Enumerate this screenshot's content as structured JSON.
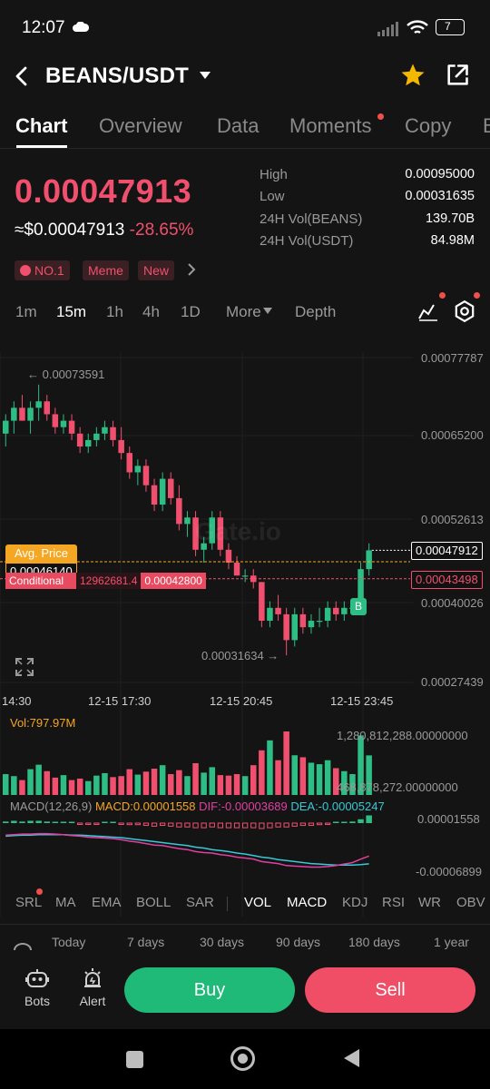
{
  "status_bar": {
    "time": "12:07",
    "battery": "7"
  },
  "header": {
    "pair": "BEANS/USDT"
  },
  "tabs": [
    {
      "label": "Chart",
      "active": true
    },
    {
      "label": "Overview"
    },
    {
      "label": "Data"
    },
    {
      "label": "Moments",
      "dot": true
    },
    {
      "label": "Copy"
    },
    {
      "label": "B"
    }
  ],
  "price": {
    "last": "0.00047913",
    "usd": "≈$0.00047913",
    "change": "-28.65%"
  },
  "tags": [
    "NO.1",
    "Meme",
    "New"
  ],
  "stats": [
    {
      "label": "High",
      "value": "0.00095000"
    },
    {
      "label": "Low",
      "value": "0.00031635"
    },
    {
      "label": "24H Vol(BEANS)",
      "value": "139.70B"
    },
    {
      "label": "24H Vol(USDT)",
      "value": "84.98M"
    }
  ],
  "timeframes": [
    "1m",
    "15m",
    "1h",
    "4h",
    "1D",
    "More",
    "Depth"
  ],
  "active_timeframe": "15m",
  "chart": {
    "y_ticks": [
      "0.00077787",
      "0.00065200",
      "0.00052613",
      "0.00040026",
      "0.00027439"
    ],
    "x_ticks": [
      "14:30",
      "12-15 17:30",
      "12-15 20:45",
      "12-15 23:45"
    ],
    "high_marker": "← 0.00073591",
    "low_marker": "0.00031634 →",
    "current_price": "0.00047912",
    "conditional_price": "0.00043498",
    "avg_price_label": "Avg. Price",
    "avg_price_value": "0.00046140",
    "conditional_label": "Conditional",
    "conditional_qty": "12962681.4",
    "conditional_order_price": "0.00042800",
    "buy_marker": "B",
    "watermark": "Gate.io",
    "colors": {
      "up": "#2ebd85",
      "down": "#f0506e",
      "avg": "#f5a623"
    }
  },
  "volume": {
    "label": "Vol:797.97M",
    "max_tick": "1,280,812,288.00000000",
    "mid_tick": "468,878,272.00000000"
  },
  "macd": {
    "params": "MACD(12,26,9)",
    "macd_value": "MACD:0.00001558",
    "dif_value": "DIF:-0.00003689",
    "dea_value": "DEA:-0.00005247",
    "top_tick": "0.00001558",
    "bottom_tick": "-0.00006899"
  },
  "indicators": [
    "SRL",
    "MA",
    "EMA",
    "BOLL",
    "SAR",
    "VOL",
    "MACD",
    "KDJ",
    "RSI",
    "WR",
    "OBV"
  ],
  "active_indicators": [
    "VOL",
    "MACD"
  ],
  "ranges": [
    "Today",
    "7 days",
    "30 days",
    "90 days",
    "180 days",
    "1 year"
  ],
  "bottom": {
    "bots": "Bots",
    "alert": "Alert",
    "buy": "Buy",
    "sell": "Sell"
  },
  "chart_data": {
    "type": "candlestick",
    "ylim": [
      0.00027439,
      0.00077787
    ],
    "candles": [
      [
        0.00066,
        0.00069,
        0.00064,
        0.00068
      ],
      [
        0.00068,
        0.00071,
        0.00066,
        0.0007
      ],
      [
        0.0007,
        0.00072,
        0.00068,
        0.00068
      ],
      [
        0.00068,
        0.00071,
        0.00066,
        0.0007
      ],
      [
        0.0007,
        0.00073591,
        0.00068,
        0.00071
      ],
      [
        0.00071,
        0.00072,
        0.00068,
        0.00069
      ],
      [
        0.00069,
        0.0007,
        0.00066,
        0.00067
      ],
      [
        0.00067,
        0.00069,
        0.00066,
        0.00068
      ],
      [
        0.00068,
        0.00069,
        0.00065,
        0.00066
      ],
      [
        0.00066,
        0.00067,
        0.00063,
        0.00064
      ],
      [
        0.00064,
        0.00066,
        0.00063,
        0.00065
      ],
      [
        0.00065,
        0.00067,
        0.00064,
        0.00066
      ],
      [
        0.00066,
        0.00068,
        0.00065,
        0.00067
      ],
      [
        0.00067,
        0.00068,
        0.00064,
        0.00065
      ],
      [
        0.00065,
        0.00067,
        0.00062,
        0.00063
      ],
      [
        0.00063,
        0.00064,
        0.00059,
        0.0006
      ],
      [
        0.0006,
        0.00062,
        0.00058,
        0.00061
      ],
      [
        0.00061,
        0.00062,
        0.00057,
        0.00058
      ],
      [
        0.00058,
        0.00059,
        0.00054,
        0.00055
      ],
      [
        0.00055,
        0.0006,
        0.00054,
        0.00059
      ],
      [
        0.00059,
        0.0006,
        0.00055,
        0.00056
      ],
      [
        0.00056,
        0.00058,
        0.00051,
        0.00052
      ],
      [
        0.00052,
        0.00054,
        0.0005,
        0.00053
      ],
      [
        0.00053,
        0.00054,
        0.00047,
        0.00048
      ],
      [
        0.00048,
        0.0005,
        0.00046,
        0.00049
      ],
      [
        0.00049,
        0.00054,
        0.00048,
        0.00053
      ],
      [
        0.00053,
        0.00054,
        0.00047,
        0.00048
      ],
      [
        0.00048,
        0.00049,
        0.00045,
        0.00046
      ],
      [
        0.00046,
        0.00047,
        0.00044,
        0.00044
      ],
      [
        0.00044,
        0.00045,
        0.00043,
        0.00044
      ],
      [
        0.00044,
        0.00045,
        0.00042,
        0.00043
      ],
      [
        0.00043,
        0.00043,
        0.00036,
        0.00037
      ],
      [
        0.00037,
        0.0004,
        0.00036,
        0.00039
      ],
      [
        0.00039,
        0.00041,
        0.00037,
        0.00038
      ],
      [
        0.00038,
        0.00039,
        0.00031634,
        0.00034
      ],
      [
        0.00034,
        0.00039,
        0.00033,
        0.00038
      ],
      [
        0.00038,
        0.00039,
        0.00035,
        0.00036
      ],
      [
        0.00036,
        0.00038,
        0.00035,
        0.00037
      ],
      [
        0.00037,
        0.00039,
        0.00036,
        0.00037
      ],
      [
        0.00037,
        0.0004,
        0.00036,
        0.00039
      ],
      [
        0.00039,
        0.0004,
        0.00037,
        0.00038
      ],
      [
        0.00038,
        0.0004,
        0.00037,
        0.00039
      ],
      [
        0.00039,
        0.0004,
        0.00038,
        0.00039
      ],
      [
        0.00039,
        0.00046,
        0.00038,
        0.00045
      ],
      [
        0.00045,
        0.00049,
        0.00044,
        0.00047913
      ]
    ],
    "volume": [
      420,
      380,
      300,
      520,
      610,
      480,
      350,
      400,
      300,
      330,
      280,
      390,
      440,
      360,
      380,
      520,
      410,
      470,
      530,
      600,
      420,
      500,
      380,
      640,
      450,
      560,
      400,
      390,
      420,
      380,
      600,
      900,
      1100,
      700,
      1280,
      800,
      760,
      650,
      620,
      700,
      540,
      480,
      420,
      1200,
      797.97
    ],
    "volume_unit": "M",
    "macd_hist": [
      0.2,
      0.3,
      0.2,
      0.3,
      0.3,
      0.2,
      0.1,
      0.1,
      0.0,
      -0.1,
      -0.1,
      -0.1,
      0.0,
      0.0,
      -0.1,
      -0.2,
      -0.2,
      -0.3,
      -0.4,
      -0.3,
      -0.4,
      -0.5,
      -0.5,
      -0.6,
      -0.6,
      -0.5,
      -0.6,
      -0.6,
      -0.6,
      -0.6,
      -0.6,
      -0.7,
      -0.6,
      -0.5,
      -0.5,
      -0.4,
      -0.3,
      -0.3,
      -0.2,
      -0.1,
      0.0,
      0.1,
      0.2,
      0.5,
      1.0
    ],
    "dif": [
      0.5,
      0.6,
      0.7,
      0.7,
      0.8,
      0.8,
      0.7,
      0.6,
      0.4,
      0.3,
      0.1,
      0.0,
      -0.1,
      -0.2,
      -0.4,
      -0.7,
      -0.9,
      -1.2,
      -1.5,
      -1.6,
      -1.9,
      -2.2,
      -2.4,
      -2.8,
      -3.0,
      -3.1,
      -3.4,
      -3.6,
      -3.9,
      -4.1,
      -4.3,
      -4.8,
      -5.0,
      -5.2,
      -5.6,
      -5.7,
      -5.8,
      -5.9,
      -5.9,
      -5.8,
      -5.6,
      -5.3,
      -5.0,
      -4.3,
      -3.689
    ],
    "dea": [
      0.3,
      0.4,
      0.5,
      0.5,
      0.6,
      0.6,
      0.6,
      0.6,
      0.5,
      0.5,
      0.4,
      0.3,
      0.2,
      0.1,
      0.0,
      -0.2,
      -0.4,
      -0.6,
      -0.8,
      -1.0,
      -1.2,
      -1.4,
      -1.6,
      -1.9,
      -2.1,
      -2.4,
      -2.6,
      -2.8,
      -3.1,
      -3.3,
      -3.6,
      -3.9,
      -4.1,
      -4.4,
      -4.6,
      -4.8,
      -5.0,
      -5.2,
      -5.3,
      -5.4,
      -5.5,
      -5.5,
      -5.5,
      -5.4,
      -5.247
    ]
  }
}
